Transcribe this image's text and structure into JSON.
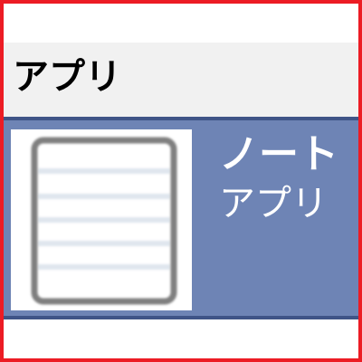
{
  "section": {
    "title": "アプリ"
  },
  "app": {
    "name": "ノート",
    "category": "アプリ",
    "icon": "notebook-icon"
  },
  "colors": {
    "frame_border": "#ec1c24",
    "header_bg": "#f1f1f1",
    "row_bg": "#6e84b5",
    "row_border": "#3f5487",
    "text_on_row": "#ffffff"
  }
}
